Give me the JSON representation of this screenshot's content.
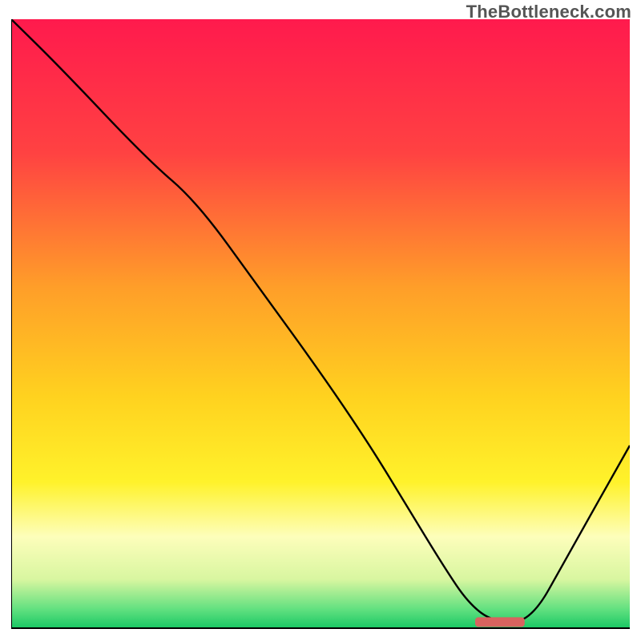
{
  "watermark": "TheBottleneck.com",
  "chart_data": {
    "type": "line",
    "title": "",
    "xlabel": "",
    "ylabel": "",
    "xlim": [
      0,
      100
    ],
    "ylim": [
      0,
      100
    ],
    "grid": false,
    "legend": false,
    "background_gradient_stops": [
      {
        "offset": 0,
        "color": "#ff1a4d"
      },
      {
        "offset": 22,
        "color": "#ff4242"
      },
      {
        "offset": 44,
        "color": "#ff9e29"
      },
      {
        "offset": 62,
        "color": "#ffd21f"
      },
      {
        "offset": 76,
        "color": "#fff22b"
      },
      {
        "offset": 85,
        "color": "#fdfebb"
      },
      {
        "offset": 92,
        "color": "#d8f6a0"
      },
      {
        "offset": 97,
        "color": "#5fe07f"
      },
      {
        "offset": 100,
        "color": "#19c764"
      }
    ],
    "series": [
      {
        "name": "bottleneck-curve",
        "x": [
          0,
          8,
          22,
          30,
          40,
          50,
          58,
          64,
          70,
          74,
          78,
          84,
          90,
          100
        ],
        "y": [
          100,
          92,
          77,
          70,
          56,
          42,
          30,
          20,
          10,
          4,
          1,
          1,
          12,
          30
        ]
      }
    ],
    "marker": {
      "name": "optimal-range",
      "x_start": 75,
      "x_end": 83,
      "y": 1,
      "color": "#d9635f"
    }
  }
}
